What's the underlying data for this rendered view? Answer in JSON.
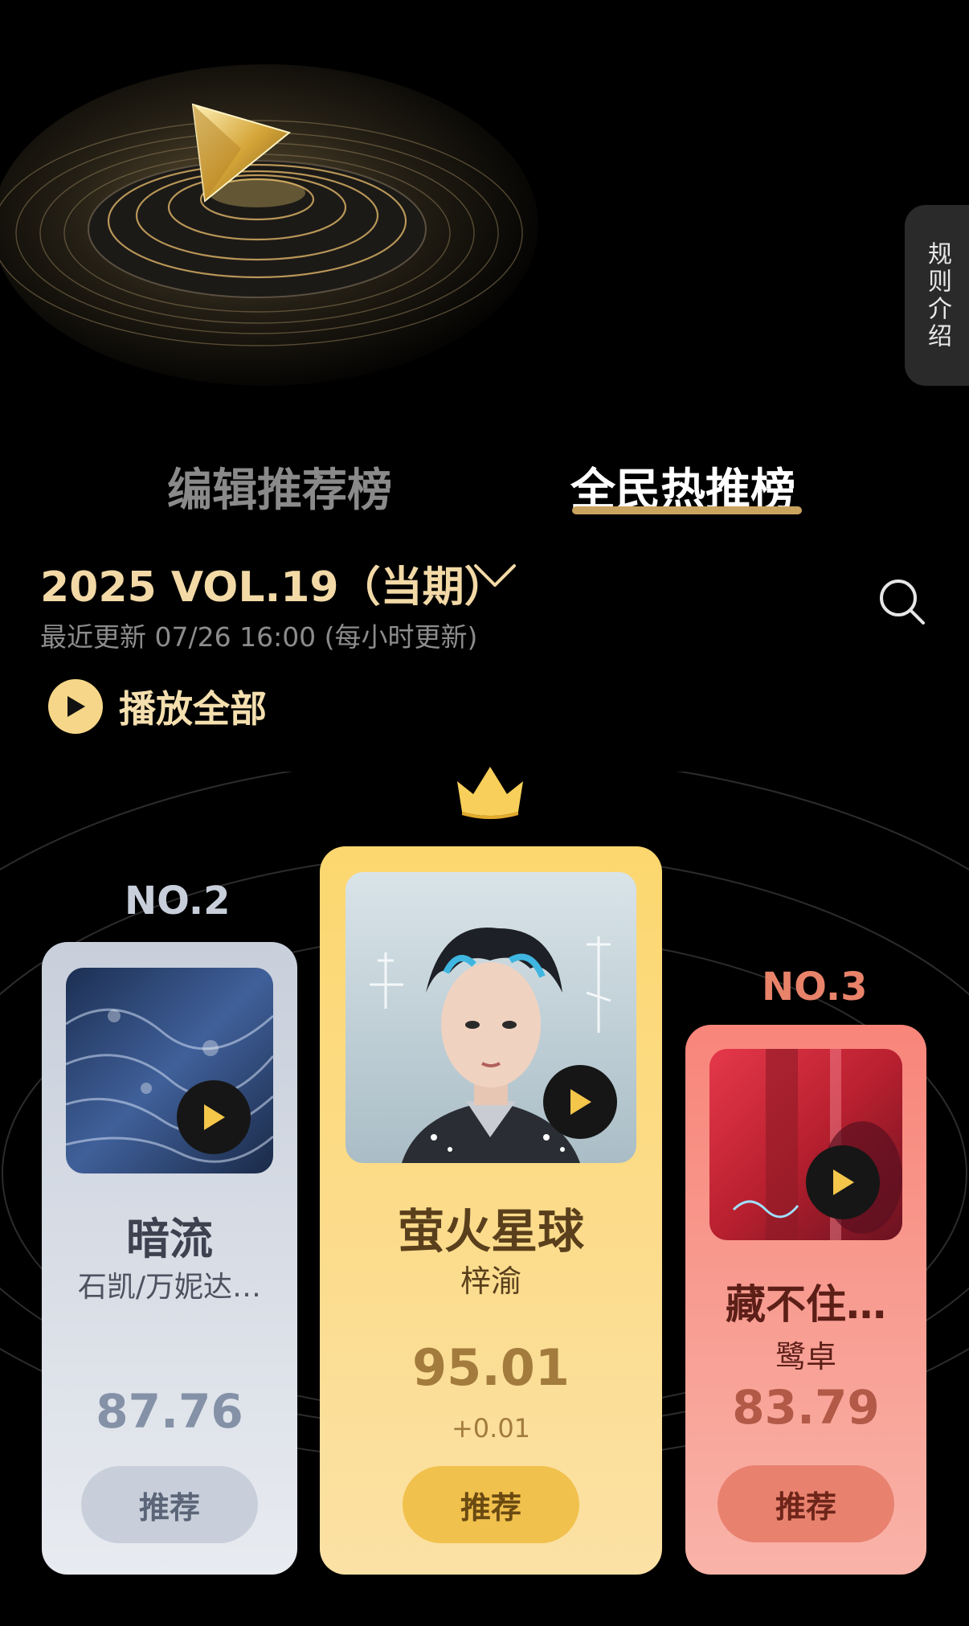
{
  "side_tab": {
    "label": "规则介绍"
  },
  "tabs": {
    "editor": "编辑推荐榜",
    "hot": "全民热推榜"
  },
  "period": {
    "label": "2025 VOL.19（当期）",
    "update": "最近更新 07/26 16:00 (每小时更新)"
  },
  "play_all": {
    "label": "播放全部"
  },
  "colors": {
    "gold": "#f2d9a6",
    "first": "#fcd76f",
    "second": "#c8cfdb",
    "third": "#f8857a"
  },
  "ranking": {
    "first": {
      "song": "萤火星球",
      "artist": "梓渝",
      "score": "95.01",
      "delta": "+0.01",
      "button": "推荐"
    },
    "second": {
      "rank": "NO.2",
      "song": "暗流",
      "artist": "石凯/万妮达…",
      "score": "87.76",
      "button": "推荐"
    },
    "third": {
      "rank": "NO.3",
      "song": "藏不住…",
      "artist": "鹭卓",
      "score": "83.79",
      "button": "推荐"
    }
  }
}
